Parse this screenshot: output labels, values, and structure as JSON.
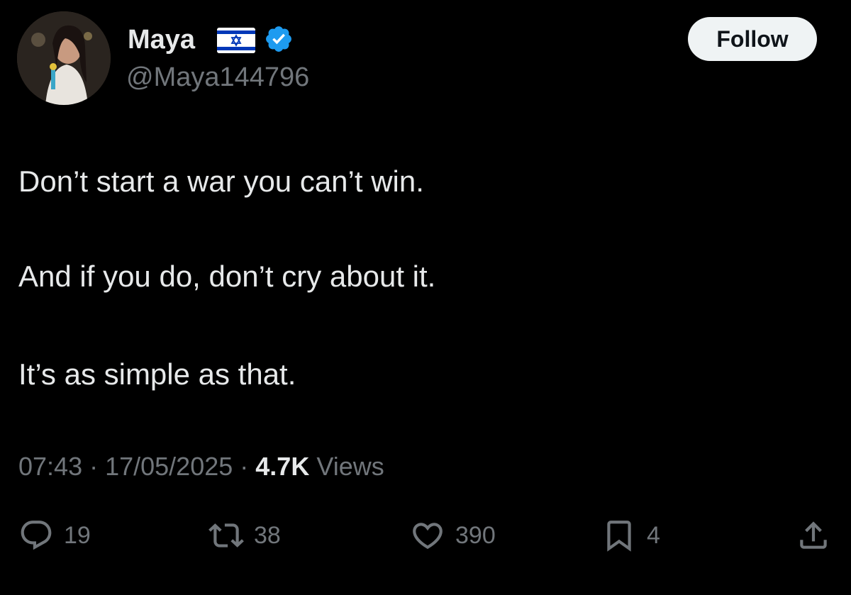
{
  "author": {
    "display_name": "Maya",
    "handle": "@Maya144796",
    "flag_icon": "israel-flag-icon",
    "verified_icon": "verified-badge-icon",
    "verified_color": "#1d9bf0"
  },
  "follow_button": {
    "label": "Follow"
  },
  "tweet": {
    "lines": [
      "Don’t start a war you can’t win.",
      "And if you do, don’t cry about it.",
      "It’s as simple as that."
    ]
  },
  "meta": {
    "time": "07:43",
    "separator": " · ",
    "date": "17/05/2025",
    "views_count": "4.7K",
    "views_label": "Views"
  },
  "actions": {
    "replies": {
      "icon": "reply-icon",
      "count": "19"
    },
    "reposts": {
      "icon": "repost-icon",
      "count": "38"
    },
    "likes": {
      "icon": "heart-icon",
      "count": "390"
    },
    "bookmarks": {
      "icon": "bookmark-icon",
      "count": "4"
    },
    "share": {
      "icon": "share-icon"
    }
  },
  "colors": {
    "background": "#000000",
    "primary_text": "#e7e9ea",
    "secondary_text": "#71767b",
    "follow_button_bg": "#eff3f4",
    "follow_button_text": "#0f1419"
  }
}
